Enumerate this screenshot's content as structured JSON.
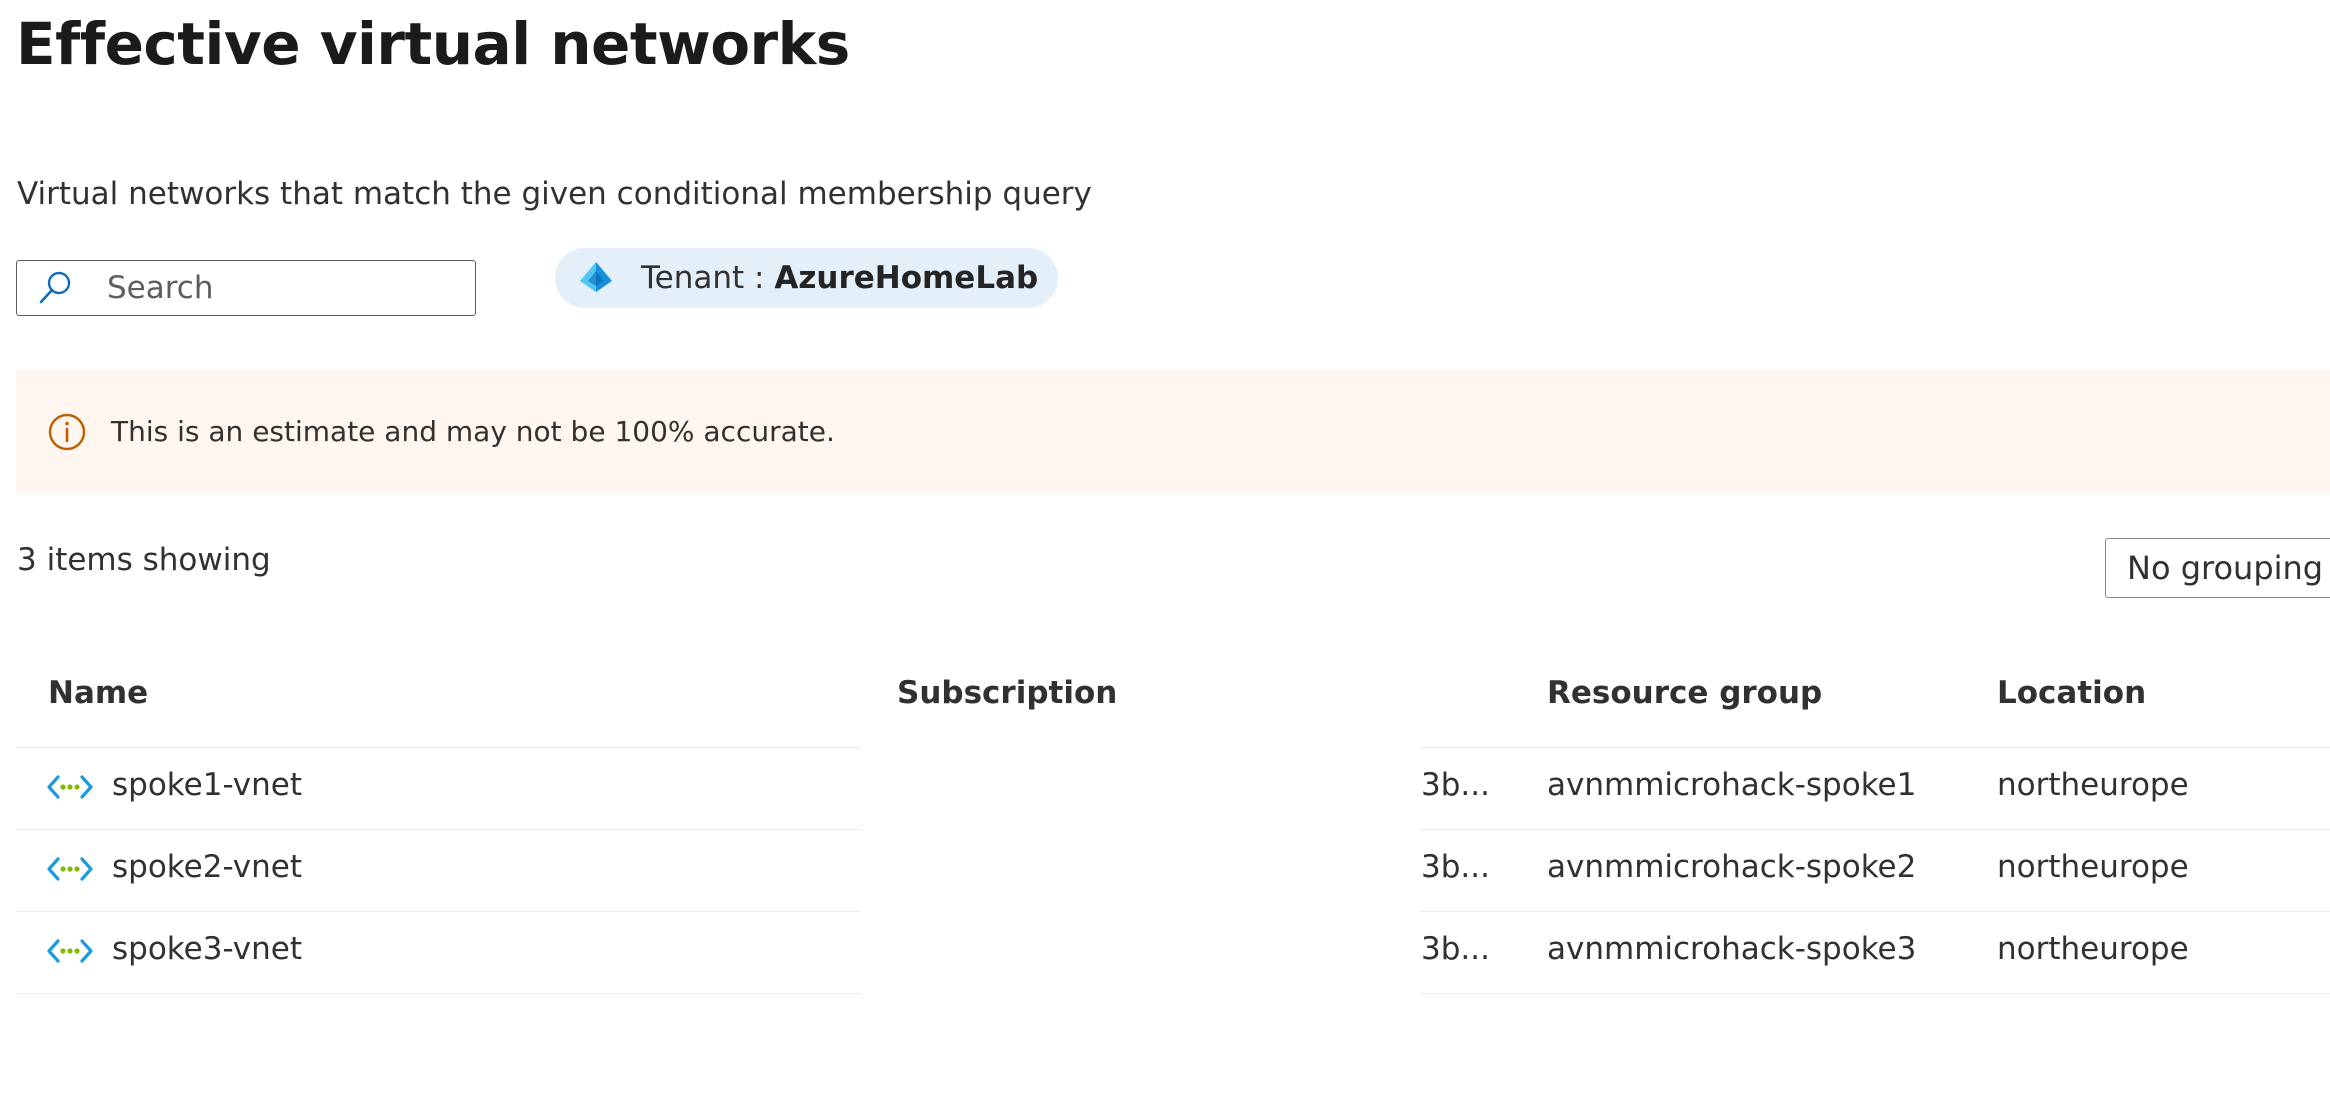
{
  "page": {
    "title": "Effective virtual networks",
    "subtitle": "Virtual networks that match the given conditional membership query"
  },
  "search": {
    "placeholder": "Search",
    "value": ""
  },
  "tenant": {
    "label": "Tenant : ",
    "value": "AzureHomeLab"
  },
  "banner": {
    "text": "This is an estimate and may not be 100% accurate.",
    "color": "#fff6f0",
    "icon": "info-icon"
  },
  "list": {
    "count_text": "3 items showing",
    "grouping_label": "No grouping"
  },
  "table": {
    "columns": [
      "Name",
      "Subscription",
      "Resource group",
      "Location"
    ],
    "rows": [
      {
        "name": "spoke1-vnet",
        "subscription": ")3b...",
        "resource_group": "avnmmicrohack-spoke1",
        "location": "northeurope"
      },
      {
        "name": "spoke2-vnet",
        "subscription": ")3b...",
        "resource_group": "avnmmicrohack-spoke2",
        "location": "northeurope"
      },
      {
        "name": "spoke3-vnet",
        "subscription": ")3b...",
        "resource_group": "avnmmicrohack-spoke3",
        "location": "northeurope"
      }
    ],
    "row_icon": "virtual-network-icon"
  }
}
